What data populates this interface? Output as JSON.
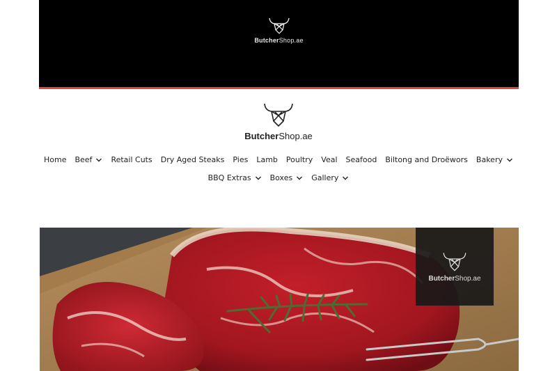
{
  "top_banner": {
    "brand_bold": "Butcher",
    "brand_rest": "Shop.ae",
    "logo_icon": "bull-head-icon",
    "accent_color": "#d9483b"
  },
  "header": {
    "brand_bold": "Butcher",
    "brand_rest": "Shop.ae",
    "logo_icon": "bull-head-icon"
  },
  "nav": {
    "row1": [
      {
        "label": "Home",
        "has_dropdown": false
      },
      {
        "label": "Beef",
        "has_dropdown": true
      },
      {
        "label": "Retail Cuts",
        "has_dropdown": false
      },
      {
        "label": "Dry Aged Steaks",
        "has_dropdown": false
      },
      {
        "label": "Pies",
        "has_dropdown": false
      },
      {
        "label": "Lamb",
        "has_dropdown": false
      },
      {
        "label": "Poultry",
        "has_dropdown": false
      },
      {
        "label": "Veal",
        "has_dropdown": false
      },
      {
        "label": "Seafood",
        "has_dropdown": false
      },
      {
        "label": "Biltong and Droëwors",
        "has_dropdown": false
      },
      {
        "label": "Bakery",
        "has_dropdown": true
      }
    ],
    "row2": [
      {
        "label": "BBQ Extras",
        "has_dropdown": true
      },
      {
        "label": "Boxes",
        "has_dropdown": true
      },
      {
        "label": "Gallery",
        "has_dropdown": true
      }
    ]
  },
  "hero": {
    "brand_bold": "Butcher",
    "brand_rest": "Shop.ae",
    "image_subject": "raw-steaks-with-rosemary"
  }
}
